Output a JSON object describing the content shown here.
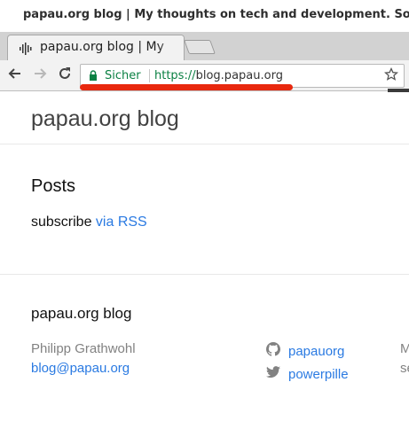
{
  "window": {
    "title": "papau.org blog | My thoughts on tech and development. Some ser"
  },
  "tab": {
    "title": "papau.org blog | My"
  },
  "toolbar": {
    "security_label": "Sicher",
    "url_scheme": "https://",
    "url_host": "blog.papau.org"
  },
  "header": {
    "site_title": "papau.org blog"
  },
  "main": {
    "posts_heading": "Posts",
    "subscribe_text": "subscribe ",
    "rss_link": "via RSS"
  },
  "footer": {
    "title": "papau.org blog",
    "author": "Philipp Grathwohl",
    "email": "blog@papau.org",
    "github": "papauorg",
    "twitter": "powerpille",
    "cutoff_1": "M",
    "cutoff_2": "se"
  },
  "colors": {
    "link": "#2a7ae2",
    "secure_green": "#0b8043",
    "annotation_red": "#e8280e"
  },
  "icons": {
    "tab": "audio-waveform-icon",
    "back": "back-arrow-icon",
    "forward": "forward-arrow-icon",
    "reload": "reload-icon",
    "lock": "lock-icon",
    "bookmark": "star-icon",
    "github": "github-icon",
    "twitter": "twitter-icon"
  }
}
